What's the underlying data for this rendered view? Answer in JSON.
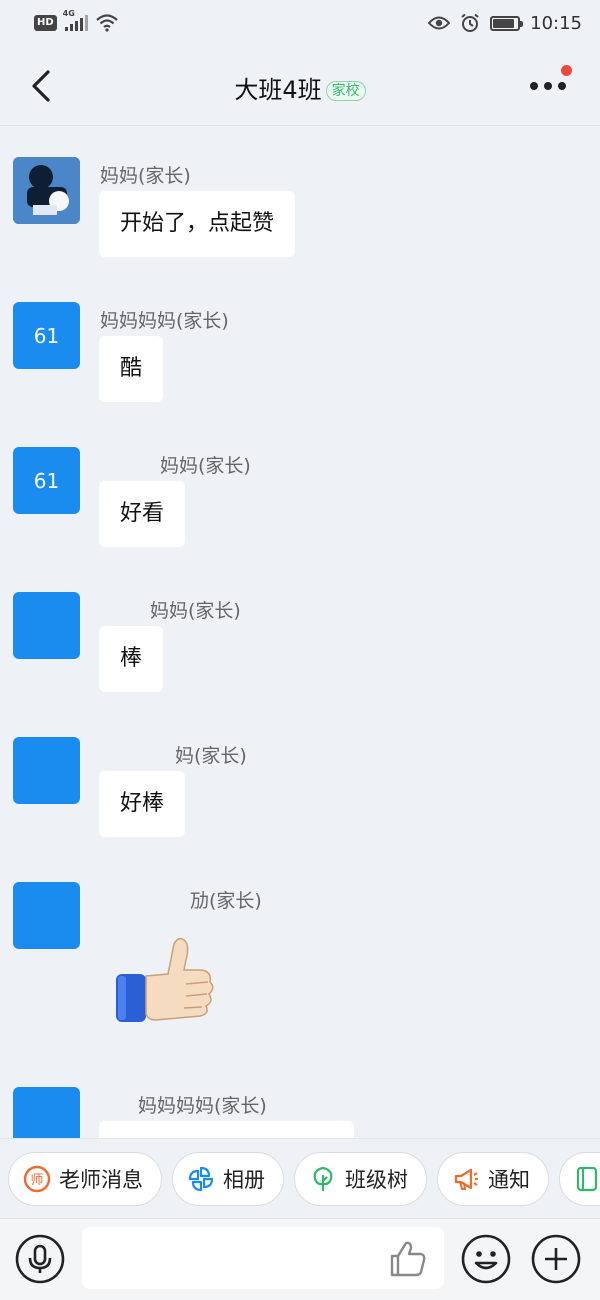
{
  "status_bar": {
    "network_badge": "HD",
    "network_type": "4G",
    "time": "10:15",
    "battery_percent": 85
  },
  "header": {
    "title": "大班4班",
    "tag": "家校"
  },
  "messages": [
    {
      "sender": "妈妈(家长)",
      "avatar_text": "",
      "text": "开始了，点起赞"
    },
    {
      "sender": "妈妈妈妈(家长)",
      "avatar_text": "61",
      "text": "酷"
    },
    {
      "sender": "妈妈(家长)",
      "avatar_text": "61",
      "text": "好看"
    },
    {
      "sender": "妈妈(家长)",
      "avatar_text": "",
      "text": "棒"
    },
    {
      "sender": "妈(家长)",
      "avatar_text": "",
      "text": "好棒"
    },
    {
      "sender": "劢(家长)",
      "avatar_text": "",
      "emoji": "thumbs-up"
    },
    {
      "sender": "妈妈妈妈(家长)",
      "avatar_text": "",
      "text": ""
    }
  ],
  "quick_actions": [
    {
      "label": "老师消息",
      "icon": "teacher-icon",
      "color": "#f06a2a"
    },
    {
      "label": "相册",
      "icon": "album-icon",
      "color": "#1a8cf0"
    },
    {
      "label": "班级树",
      "icon": "tree-icon",
      "color": "#2fb86a"
    },
    {
      "label": "通知",
      "icon": "megaphone-icon",
      "color": "#f06a2a"
    },
    {
      "label": "",
      "icon": "notebook-icon",
      "color": "#2fb86a"
    }
  ],
  "input": {
    "placeholder": ""
  },
  "colors": {
    "accent_blue": "#1a8cf0",
    "tag_green": "#3cb371",
    "badge_red": "#f0473c"
  }
}
